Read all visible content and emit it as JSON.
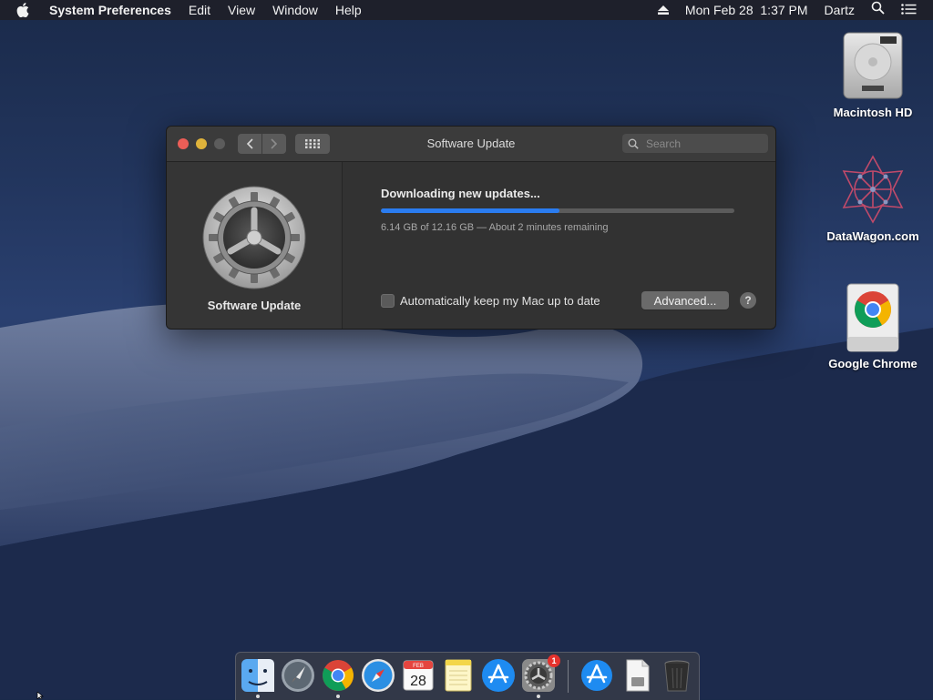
{
  "menubar": {
    "app_name": "System Preferences",
    "items": [
      "Edit",
      "View",
      "Window",
      "Help"
    ],
    "clock": "Mon Feb 28  1:37 PM",
    "user": "Dartz"
  },
  "desktop": {
    "icons": [
      {
        "label": "Macintosh HD",
        "icon": "hard-drive-icon"
      },
      {
        "label": "DataWagon.com",
        "icon": "datawagon-logo-icon"
      },
      {
        "label": "Google Chrome",
        "icon": "chrome-disk-icon"
      }
    ]
  },
  "window": {
    "title": "Software Update",
    "search_placeholder": "Search",
    "sidebar_label": "Software Update",
    "download_title": "Downloading new updates...",
    "progress_fraction": 0.505,
    "status_text": "6.14 GB of 12.16 GB — About 2 minutes remaining",
    "auto_update_label": "Automatically keep my Mac up to date",
    "auto_update_checked": false,
    "advanced_label": "Advanced...",
    "help_label": "?"
  },
  "dock": {
    "items": [
      {
        "name": "Finder",
        "icon": "finder-icon",
        "running": true
      },
      {
        "name": "Launchpad",
        "icon": "launchpad-icon",
        "running": false
      },
      {
        "name": "Google Chrome",
        "icon": "chrome-icon",
        "running": true
      },
      {
        "name": "Safari",
        "icon": "safari-icon",
        "running": false
      },
      {
        "name": "Calendar",
        "icon": "calendar-icon",
        "running": false,
        "month": "FEB",
        "day": "28"
      },
      {
        "name": "Notes",
        "icon": "notes-icon",
        "running": false
      },
      {
        "name": "App Store",
        "icon": "app-store-icon",
        "running": false
      },
      {
        "name": "System Preferences",
        "icon": "system-preferences-icon",
        "running": true,
        "badge": "1"
      },
      {
        "name": "App Store Downloads",
        "icon": "app-store-folder-icon",
        "running": false
      },
      {
        "name": "Installer Document",
        "icon": "document-icon",
        "running": false
      },
      {
        "name": "Trash",
        "icon": "trash-icon",
        "running": false
      }
    ]
  }
}
